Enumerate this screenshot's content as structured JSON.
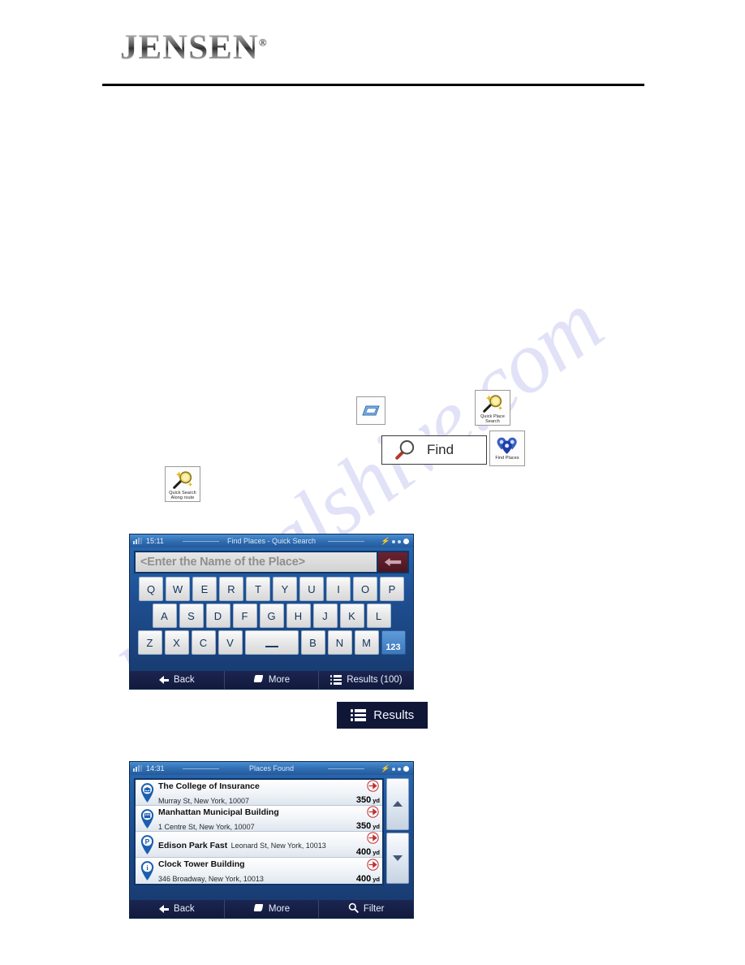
{
  "header": {
    "brand": "JENSEN",
    "trademark": "®"
  },
  "icons": {
    "menu_tile": {
      "name": "menu-3d-icon"
    },
    "quick_place_search": {
      "line1": "Quick Place",
      "line2": "Search"
    },
    "quick_search_along_route": {
      "line1": "Quick Search",
      "line2": "Along route"
    },
    "find_places": {
      "label": "Find Places"
    }
  },
  "find_button": {
    "label": "Find"
  },
  "results_button": {
    "label": "Results"
  },
  "keyboard_screen": {
    "clock": "15:11",
    "title": "Find Places - Quick Search",
    "input_placeholder": "<Enter the Name of the Place>",
    "backspace": "backspace-arrow-icon",
    "rows": [
      [
        "Q",
        "W",
        "E",
        "R",
        "T",
        "Y",
        "U",
        "I",
        "O",
        "P"
      ],
      [
        "A",
        "S",
        "D",
        "F",
        "G",
        "H",
        "J",
        "K",
        "L"
      ],
      [
        "Z",
        "X",
        "C",
        "V",
        "SPACE",
        "B",
        "N",
        "M",
        "123"
      ]
    ],
    "toolbar": {
      "back": "Back",
      "more": "More",
      "results": "Results (100)"
    }
  },
  "results_screen": {
    "clock": "14:31",
    "title": "Places Found",
    "items": [
      {
        "name": "The College of Insurance",
        "address": "Murray St, New York, 10007",
        "distance": "350",
        "unit": "yd",
        "pin": "graduation-cap-pin-icon"
      },
      {
        "name": "Manhattan Municipal Building",
        "address": "1 Centre St, New York, 10007",
        "distance": "350",
        "unit": "yd",
        "pin": "building-pin-icon"
      },
      {
        "name": "Edison Park Fast",
        "address": "Leonard St, New York, 10013",
        "distance": "400",
        "unit": "yd",
        "pin": "parking-pin-icon"
      },
      {
        "name": "Clock Tower Building",
        "address": "346 Broadway, New York, 10013",
        "distance": "400",
        "unit": "yd",
        "pin": "info-pin-icon"
      }
    ],
    "toolbar": {
      "back": "Back",
      "more": "More",
      "filter": "Filter"
    }
  },
  "watermark": {
    "text": "manualshive.com"
  },
  "colors": {
    "device_blue": "#2a6bb5",
    "toolbar_navy": "#0d1535",
    "accent_maroon": "#6d2230",
    "pin_blue": "#1a5fb0"
  }
}
